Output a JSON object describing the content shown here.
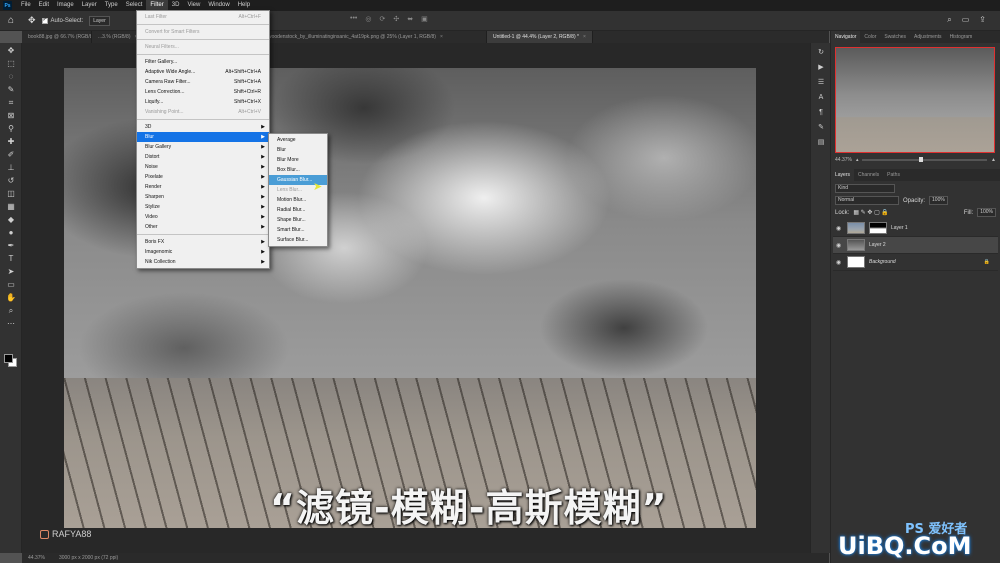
{
  "app": {
    "logo": "Ps"
  },
  "menubar": {
    "items": [
      "File",
      "Edit",
      "Image",
      "Layer",
      "Type",
      "Select",
      "Filter",
      "3D",
      "View",
      "Window",
      "Help"
    ],
    "active": "Filter"
  },
  "options": {
    "auto_select_label": "Auto-Select:",
    "auto_select_target": "Layer"
  },
  "tabs": [
    {
      "label": "book88.jpg @ 66.7% (RGB/8#)",
      "active": false
    },
    {
      "label": "...3.% (RGB/8)",
      "active": false
    },
    {
      "label": "woodenstock_by_illuminatinginsanic_4at19pk.png @ 25% (Layer 1, RGB/8)",
      "active": false
    },
    {
      "label": "Untitled-1 @ 44.4% (Layer 2, RGB/8) *",
      "active": true
    }
  ],
  "filter_menu": {
    "items": [
      {
        "label": "Last Filter",
        "shortcut": "Alt+Ctrl+F",
        "disabled": true
      },
      {
        "sep": true
      },
      {
        "label": "Convert for Smart Filters",
        "disabled": true
      },
      {
        "sep": true
      },
      {
        "label": "Neural Filters...",
        "disabled": true
      },
      {
        "sep": true
      },
      {
        "label": "Filter Gallery..."
      },
      {
        "label": "Adaptive Wide Angle...",
        "shortcut": "Alt+Shift+Ctrl+A"
      },
      {
        "label": "Camera Raw Filter...",
        "shortcut": "Shift+Ctrl+A"
      },
      {
        "label": "Lens Correction...",
        "shortcut": "Shift+Ctrl+R"
      },
      {
        "label": "Liquify...",
        "shortcut": "Shift+Ctrl+X"
      },
      {
        "label": "Vanishing Point...",
        "shortcut": "Alt+Ctrl+V",
        "disabled": true
      },
      {
        "sep": true
      },
      {
        "label": "3D",
        "submenu": true
      },
      {
        "label": "Blur",
        "submenu": true,
        "highlighted": true
      },
      {
        "label": "Blur Gallery",
        "submenu": true
      },
      {
        "label": "Distort",
        "submenu": true
      },
      {
        "label": "Noise",
        "submenu": true
      },
      {
        "label": "Pixelate",
        "submenu": true
      },
      {
        "label": "Render",
        "submenu": true
      },
      {
        "label": "Sharpen",
        "submenu": true
      },
      {
        "label": "Stylize",
        "submenu": true
      },
      {
        "label": "Video",
        "submenu": true
      },
      {
        "label": "Other",
        "submenu": true
      },
      {
        "sep": true
      },
      {
        "label": "Boris FX",
        "submenu": true
      },
      {
        "label": "Imagenomic",
        "submenu": true
      },
      {
        "label": "Nik Collection",
        "submenu": true
      }
    ]
  },
  "blur_submenu": {
    "items": [
      {
        "label": "Average"
      },
      {
        "label": "Blur"
      },
      {
        "label": "Blur More"
      },
      {
        "label": "Box Blur..."
      },
      {
        "label": "Gaussian Blur...",
        "highlighted": true
      },
      {
        "label": "Lens Blur...",
        "disabled": true
      },
      {
        "label": "Motion Blur..."
      },
      {
        "label": "Radial Blur..."
      },
      {
        "label": "Shape Blur..."
      },
      {
        "label": "Smart Blur..."
      },
      {
        "label": "Surface Blur..."
      }
    ]
  },
  "canvas": {
    "subtitle": "“滤镜-模糊-高斯模糊”",
    "watermark": "RAFYA88"
  },
  "statusbar": {
    "zoom": "44.37%",
    "doc_info": "3000 px x 2000 px (72 ppi)"
  },
  "navigator": {
    "tabs": [
      "Navigator",
      "Color",
      "Swatches",
      "Adjustments",
      "Histogram"
    ],
    "active": "Navigator",
    "zoom": "44.37%"
  },
  "layers_panel": {
    "tabs": [
      "Layers",
      "Channels",
      "Paths"
    ],
    "active": "Layers",
    "filter_kind": "Kind",
    "blend_mode": "Normal",
    "opacity_label": "Opacity:",
    "opacity": "100%",
    "lock_label": "Lock:",
    "fill_label": "Fill:",
    "fill": "100%",
    "layers": [
      {
        "name": "Layer 1",
        "selected": false,
        "has_mask": true
      },
      {
        "name": "Layer 2",
        "selected": true,
        "has_mask": false
      },
      {
        "name": "Background",
        "selected": false,
        "locked": true
      }
    ]
  },
  "brand": {
    "text": "UiBQ.CoM",
    "small": "PS 爱好者"
  },
  "colors": {
    "highlight": "#1473e6",
    "submenu_highlight": "#4a9dd6",
    "nav_frame": "#e03030"
  }
}
